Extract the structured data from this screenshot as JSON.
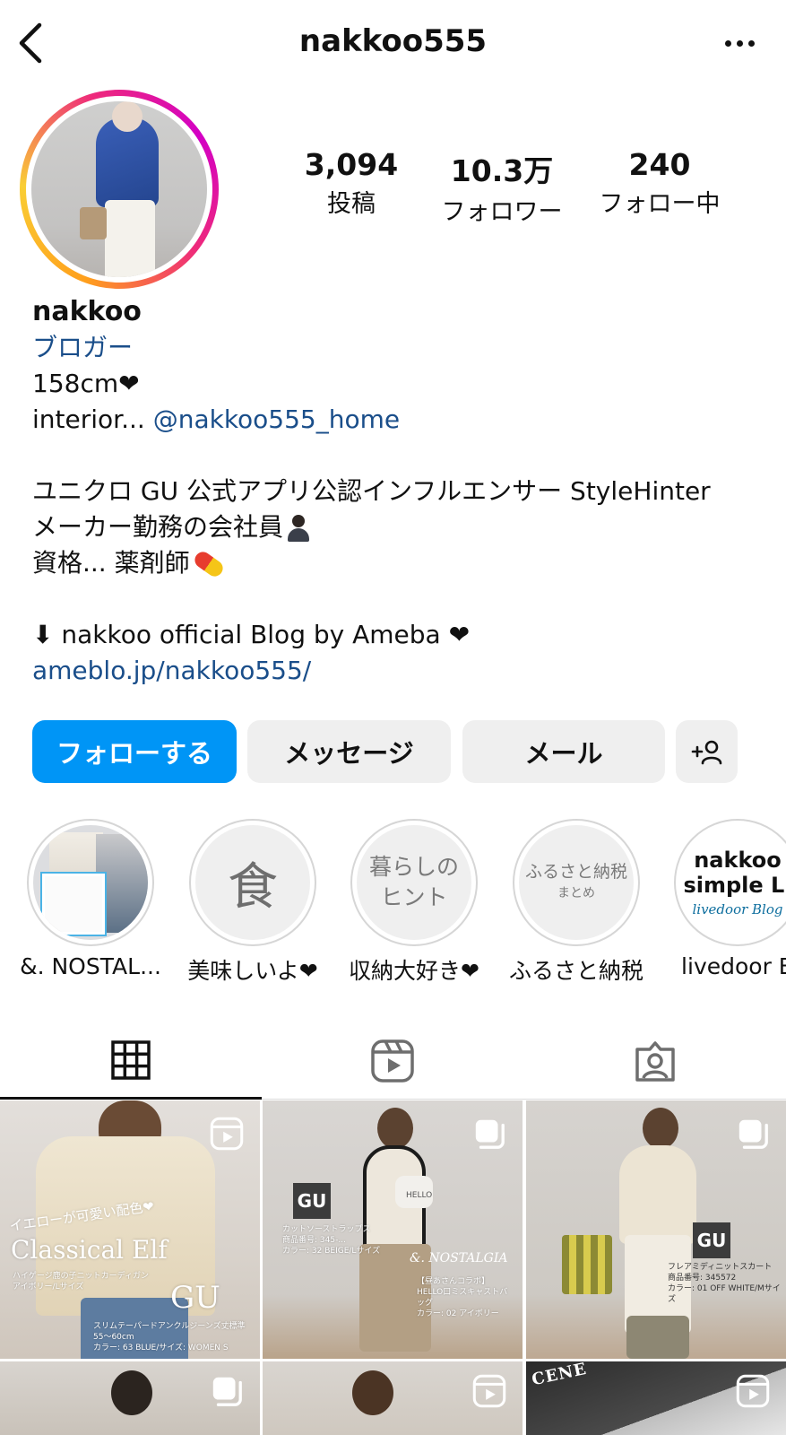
{
  "header": {
    "username": "nakkoo555"
  },
  "stats": {
    "posts": {
      "value": "3,094",
      "label": "投稿"
    },
    "followers": {
      "value": "10.3万",
      "label": "フォロワー"
    },
    "following": {
      "value": "240",
      "label": "フォロー中"
    }
  },
  "bio": {
    "name": "nakkoo",
    "category": "ブロガー",
    "line1": "158cm❤",
    "line2_prefix": "interior... ",
    "line2_link": "@nakkoo555_home",
    "line3": "ユニクロ GU 公式アプリ公認インフルエンサー StyleHinter",
    "line4": "メーカー勤務の会社員",
    "line5": "資格... 薬剤師",
    "line6": "⬇ nakkoo official Blog by Ameba ❤",
    "link": "ameblo.jp/nakkoo555/"
  },
  "actions": {
    "follow": "フォローする",
    "message": "メッセージ",
    "mail": "メール"
  },
  "highlights": [
    {
      "label": "&. NOSTAL..."
    },
    {
      "label": "美味しいよ❤",
      "cover_text": "食"
    },
    {
      "label": "収納大好き❤",
      "cover_line1": "暮らしの",
      "cover_line2": "ヒント"
    },
    {
      "label": "ふるさと納税",
      "cover_line1": "ふるさと納税",
      "cover_line2": "まとめ"
    },
    {
      "label": "livedoor B",
      "cover_line1": "nakkoo",
      "cover_line2": "simple Li",
      "cover_line3": "livedoor Blog"
    }
  ],
  "posts": {
    "p1": {
      "text_yellow": "イエローが可愛い配色❤",
      "text_title": "Classical Elf",
      "text_sub": "ハイゲージ鹿の子ニットカーディガン\nアイボリー/Lサイズ",
      "text_gu": "GU",
      "text_bottom": "スリムテーパードアンクルジーンズ丈標準55〜60cm\nカラー: 63 BLUE/サイズ: WOMEN S"
    },
    "p2": {
      "logo": "GU",
      "text_info": "カットソーストラップス\n商品番号: 345-...\nカラー: 32 BEIGE/Lサイズ",
      "bag_text": "HELLO",
      "text_brand": "&. NOSTALGIA",
      "text_bottom": "【昼あさんコラボ】\nHELLO口ミスキャストバッグ\nカラー: 02 アイボリー"
    },
    "p3": {
      "logo": "GU",
      "text_info": "フレアミディニットスカート\n商品番号: 345572\nカラー: 01 OFF WHITE/Mサイズ"
    },
    "p6": {
      "text": "CENE"
    }
  },
  "colors": {
    "primary": "#0095f6",
    "link": "#1a4e8a",
    "secondary_bg": "#efefef"
  },
  "icons": {
    "back": "chevron-left-icon",
    "more": "more-horizontal-icon",
    "add_user": "add-user-icon",
    "grid": "grid-icon",
    "reels": "reels-icon",
    "tagged": "tagged-icon",
    "carousel": "carousel-icon"
  }
}
